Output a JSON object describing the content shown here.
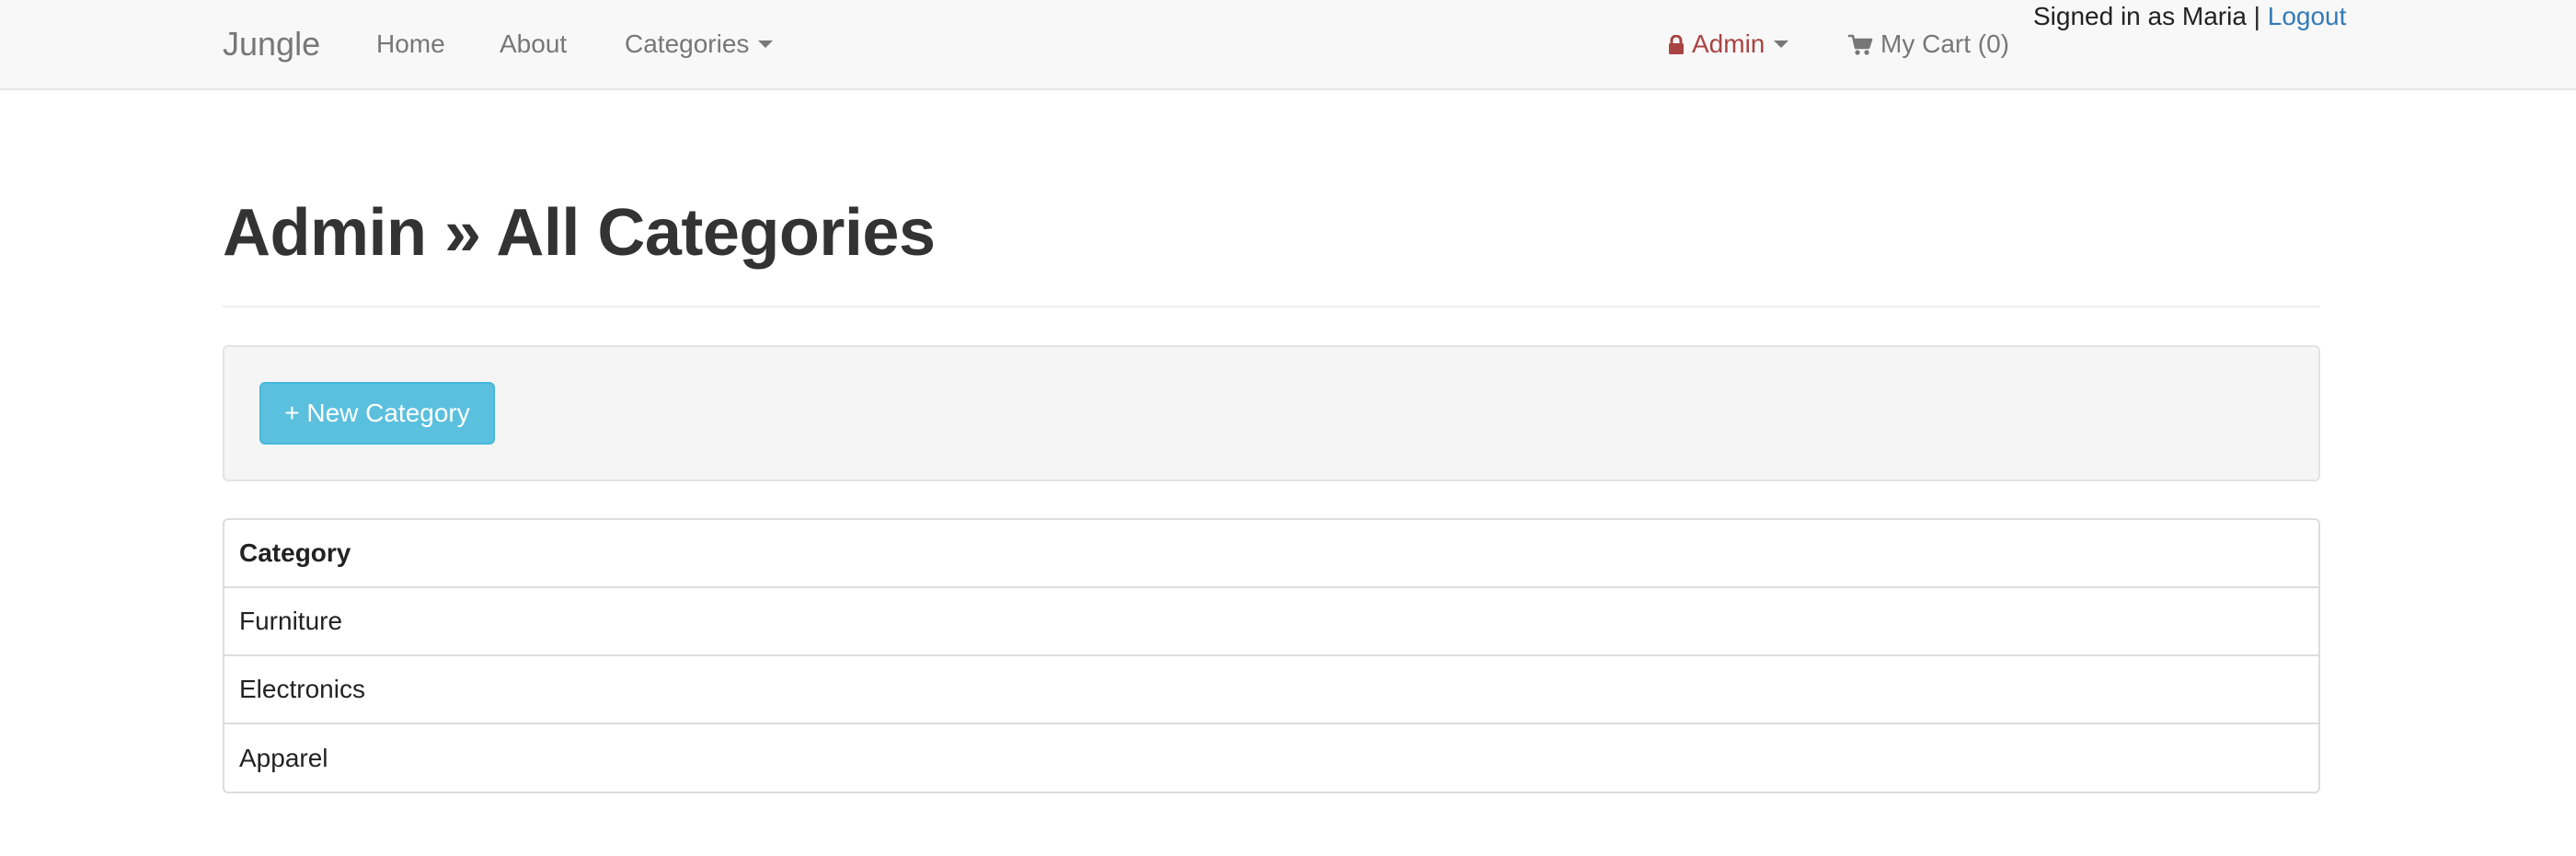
{
  "navbar": {
    "brand": "Jungle",
    "links": [
      {
        "label": "Home"
      },
      {
        "label": "About"
      },
      {
        "label": "Categories"
      }
    ],
    "admin_label": "Admin",
    "cart_label": "My Cart (0)",
    "signed_in_text": "Signed in as Maria |",
    "logout_label": "Logout"
  },
  "page": {
    "title": "Admin » All Categories",
    "new_category_button": "+ New Category"
  },
  "table": {
    "header": "Category",
    "rows": [
      "Furniture",
      "Electronics",
      "Apparel"
    ]
  },
  "colors": {
    "navbar_bg": "#f8f8f8",
    "admin_red": "#a94442",
    "link_blue": "#337ab7",
    "button_info": "#5bc0de"
  },
  "icons": {
    "admin": "lock-icon",
    "cart": "shopping-cart-icon",
    "dropdown": "caret-down-icon"
  }
}
